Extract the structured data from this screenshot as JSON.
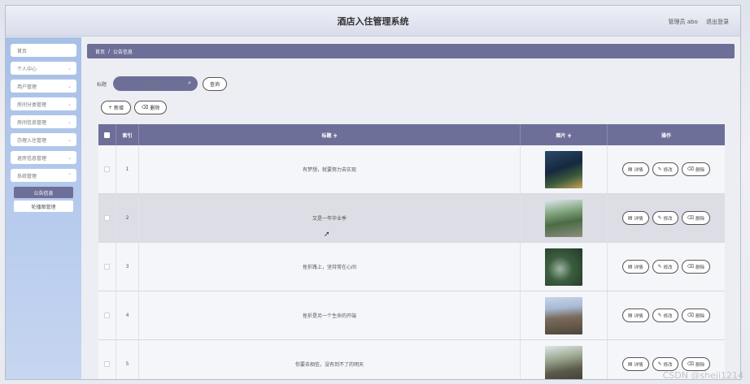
{
  "header": {
    "title": "酒店入住管理系统",
    "user_label": "管理员 abo",
    "logout_label": "退出登录"
  },
  "sidebar": {
    "items": [
      {
        "label": "首页"
      },
      {
        "label": "个人中心"
      },
      {
        "label": "用户管理"
      },
      {
        "label": "房间分类管理"
      },
      {
        "label": "房间信息管理"
      },
      {
        "label": "办理入住管理"
      },
      {
        "label": "退房信息管理"
      },
      {
        "label": "系统管理"
      }
    ],
    "subitems": [
      {
        "label": "公告信息"
      },
      {
        "label": "轮播图管理"
      }
    ]
  },
  "breadcrumb": {
    "home": "首页",
    "sep": "/",
    "current": "公告信息"
  },
  "search": {
    "label": "标题",
    "placeholder": "标题",
    "button": "查询"
  },
  "actions": {
    "add": "新增",
    "delete": "删除"
  },
  "table": {
    "headers": {
      "index": "索引",
      "title": "标题 ≑",
      "image": "图片 ≑",
      "ops": "操作"
    },
    "op_labels": {
      "detail": "详情",
      "edit": "修改",
      "delete": "删除"
    },
    "rows": [
      {
        "index": "1",
        "title": "有梦想，就要努力去实现"
      },
      {
        "index": "2",
        "title": "又是一年毕业季"
      },
      {
        "index": "3",
        "title": "挫折路上，坚持常在心间"
      },
      {
        "index": "4",
        "title": "挫折是另一个生命的开端"
      },
      {
        "index": "5",
        "title": "你要去相信，没有到不了的明天"
      }
    ]
  },
  "watermark": "CSDN @sheji1214",
  "colors": {
    "accent": "#6e6f99",
    "sidebar": "#b9cdee"
  }
}
